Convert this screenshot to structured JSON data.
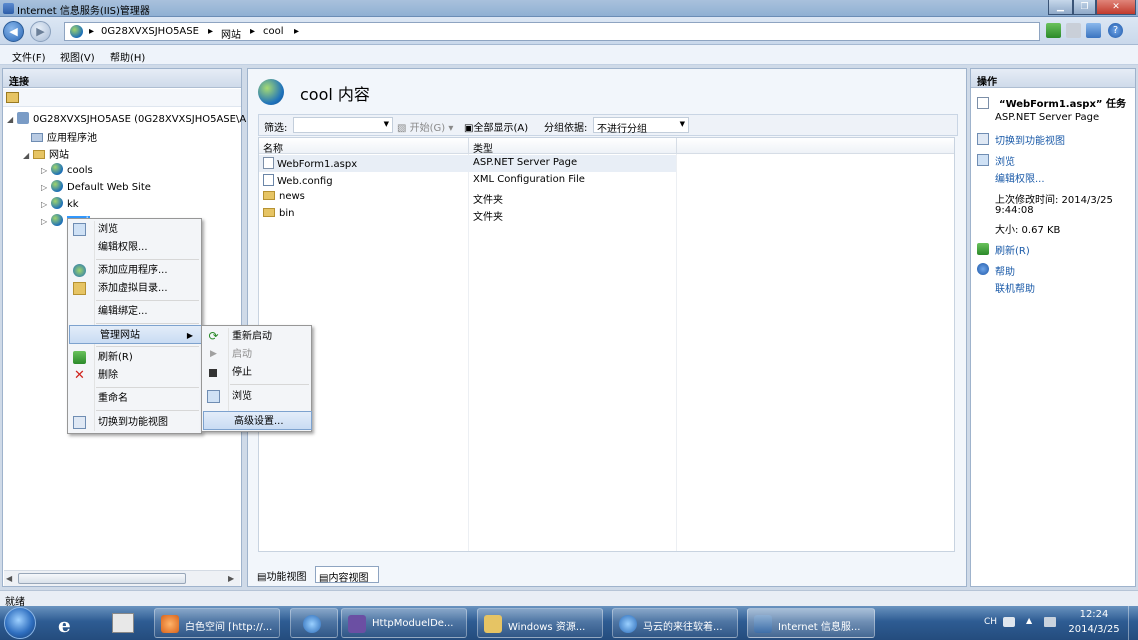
{
  "window": {
    "title": "Internet 信息服务(IIS)管理器"
  },
  "address": {
    "crumbs": [
      "0G28XVXSJHO5ASE",
      "网站",
      "cool"
    ]
  },
  "menu": [
    "文件(F)",
    "视图(V)",
    "帮助(H)"
  ],
  "left": {
    "header": "连接",
    "tree": {
      "server": "0G28XVXSJHO5ASE (0G28XVXSJHO5ASE\\A",
      "app_pools": "应用程序池",
      "sites": "网站",
      "site_items": [
        "cools",
        "Default Web Site",
        "kk",
        "cool"
      ]
    }
  },
  "context_menu": {
    "items": [
      "浏览",
      "编辑权限...",
      "添加应用程序...",
      "添加虚拟目录...",
      "编辑绑定...",
      "管理网站",
      "刷新(R)",
      "删除",
      "重命名",
      "切换到功能视图"
    ]
  },
  "submenu": {
    "items": [
      "重新启动",
      "启动",
      "停止",
      "浏览",
      "高级设置..."
    ]
  },
  "center": {
    "title": "cool 内容",
    "filter_label": "筛选:",
    "start_label": "开始(G)",
    "show_all_label": "全部显示(A)",
    "group_label": "分组依据:",
    "group_value": "不进行分组",
    "columns": [
      "名称",
      "类型"
    ],
    "rows": [
      {
        "name": "WebForm1.aspx",
        "type": "ASP.NET Server Page"
      },
      {
        "name": "Web.config",
        "type": "XML Configuration File"
      },
      {
        "name": "news",
        "type": "文件夹"
      },
      {
        "name": "bin",
        "type": "文件夹"
      }
    ],
    "views": [
      "功能视图",
      "内容视图"
    ]
  },
  "right": {
    "header": "操作",
    "task_title": "“WebForm1.aspx” 任务",
    "task_type": "ASP.NET Server Page",
    "switch_view": "切换到功能视图",
    "browse": "浏览",
    "edit_perm": "编辑权限...",
    "modified_label": "上次修改时间: 2014/3/25",
    "modified_time": "9:44:08",
    "size": "大小: 0.67 KB",
    "refresh": "刷新(R)",
    "help": "帮助",
    "online_help": "联机帮助"
  },
  "status": "就绪",
  "taskbar": {
    "tasks": [
      "白色空间 [http://...",
      "HttpModuelDe...",
      "Windows 资源...",
      "马云的来往软着...",
      "Internet 信息服..."
    ],
    "lang": "CH",
    "time": "12:24",
    "date": "2014/3/25"
  }
}
